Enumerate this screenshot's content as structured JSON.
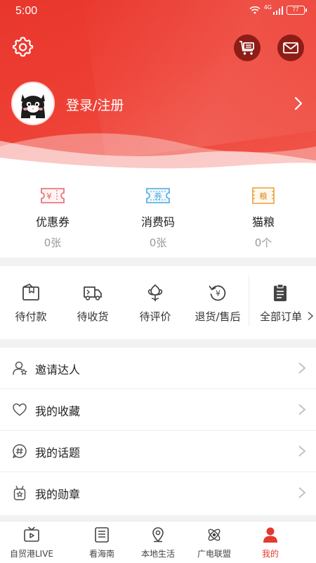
{
  "status_bar": {
    "time": "5:00",
    "signal_label": "4G",
    "battery": "77"
  },
  "header": {
    "login_label": "登录/注册",
    "settings_icon": "gear-icon",
    "cart_icon": "cart-list-icon",
    "mail_icon": "mail-icon",
    "brand_color": "#e8362c"
  },
  "wallet": {
    "items": [
      {
        "label": "优惠券",
        "value": "0张",
        "icon": "coupon-icon",
        "glyph": "¥",
        "color": "#e8646a"
      },
      {
        "label": "消费码",
        "value": "0张",
        "icon": "voucher-code-icon",
        "glyph": "券",
        "color": "#4aa8e0"
      },
      {
        "label": "猫粮",
        "value": "0个",
        "icon": "cat-food-icon",
        "glyph": "粮",
        "color": "#e8a238"
      }
    ]
  },
  "orders": {
    "items": [
      {
        "label": "待付款",
        "icon": "wallet-icon"
      },
      {
        "label": "待收货",
        "icon": "truck-icon"
      },
      {
        "label": "待评价",
        "icon": "flower-icon"
      },
      {
        "label": "退货/售后",
        "icon": "refund-icon"
      },
      {
        "label": "全部订单",
        "icon": "clipboard-icon"
      }
    ]
  },
  "menu": {
    "items": [
      {
        "label": "邀请达人",
        "icon": "invite-user-icon"
      },
      {
        "label": "我的收藏",
        "icon": "heart-icon"
      },
      {
        "label": "我的话题",
        "icon": "hashtag-icon"
      },
      {
        "label": "我的勋章",
        "icon": "medal-icon"
      }
    ]
  },
  "bottom_nav": {
    "items": [
      {
        "label": "自贸港LIVE",
        "icon": "tv-icon"
      },
      {
        "label": "看海南",
        "icon": "news-list-icon"
      },
      {
        "label": "本地生活",
        "icon": "location-pin-icon"
      },
      {
        "label": "广电联盟",
        "icon": "atom-icon"
      },
      {
        "label": "我的",
        "icon": "person-icon",
        "active": true
      }
    ],
    "active_color": "#e33a2f"
  }
}
